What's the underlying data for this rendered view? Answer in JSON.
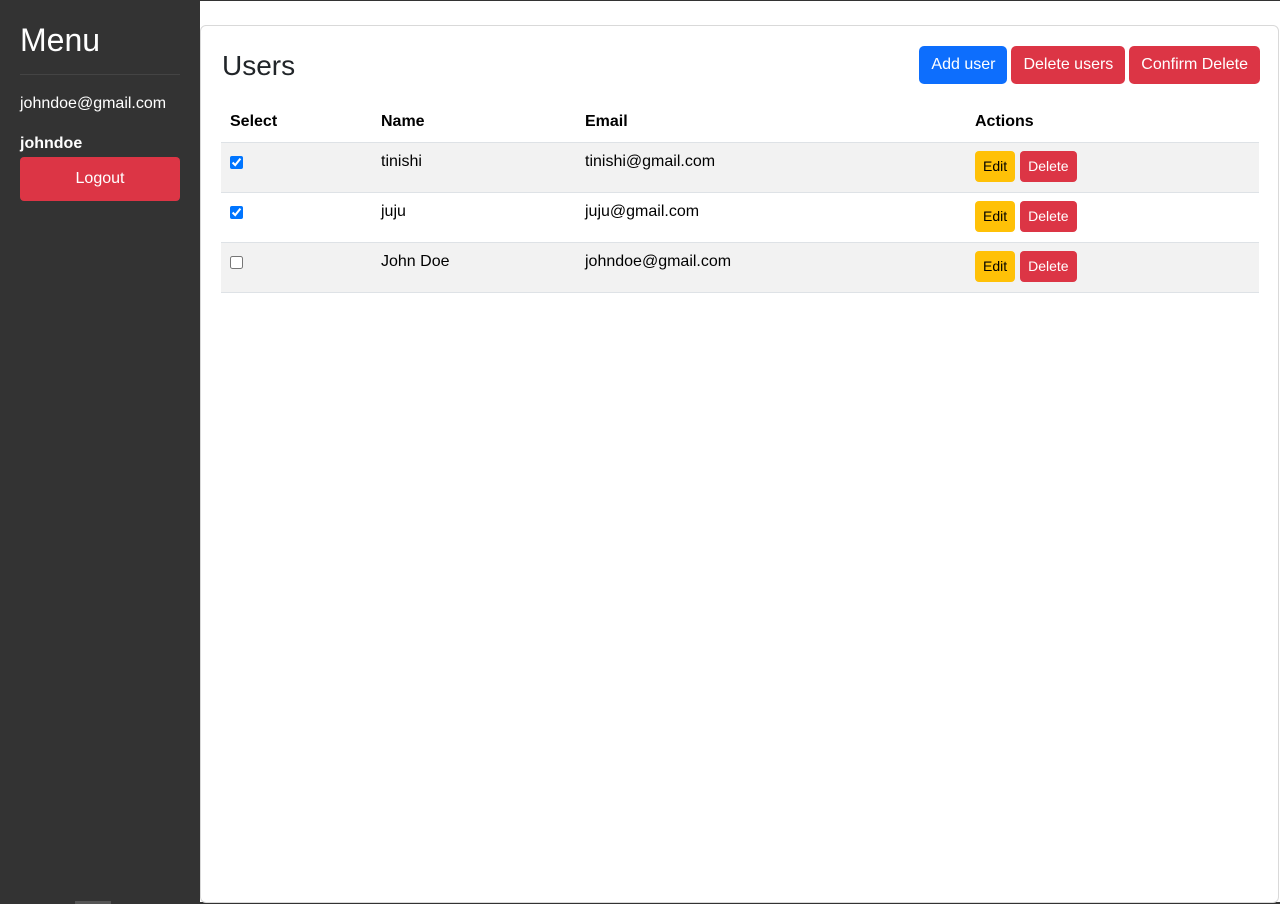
{
  "sidebar": {
    "title": "Menu",
    "email": "johndoe@gmail.com",
    "username": "johndoe",
    "logout_label": "Logout"
  },
  "main": {
    "title": "Users",
    "actions": {
      "add_user": "Add user",
      "delete_users": "Delete users",
      "confirm_delete": "Confirm Delete"
    },
    "table": {
      "headers": {
        "select": "Select",
        "name": "Name",
        "email": "Email",
        "actions": "Actions"
      },
      "rows": [
        {
          "selected": true,
          "name": "tinishi",
          "email": "tinishi@gmail.com",
          "edit_label": "Edit",
          "delete_label": "Delete"
        },
        {
          "selected": true,
          "name": "juju",
          "email": "juju@gmail.com",
          "edit_label": "Edit",
          "delete_label": "Delete"
        },
        {
          "selected": false,
          "name": "John Doe",
          "email": "johndoe@gmail.com",
          "edit_label": "Edit",
          "delete_label": "Delete"
        }
      ]
    }
  },
  "colors": {
    "sidebar_bg": "#333333",
    "primary": "#0d6efd",
    "danger": "#dc3545",
    "warning": "#ffc107"
  }
}
